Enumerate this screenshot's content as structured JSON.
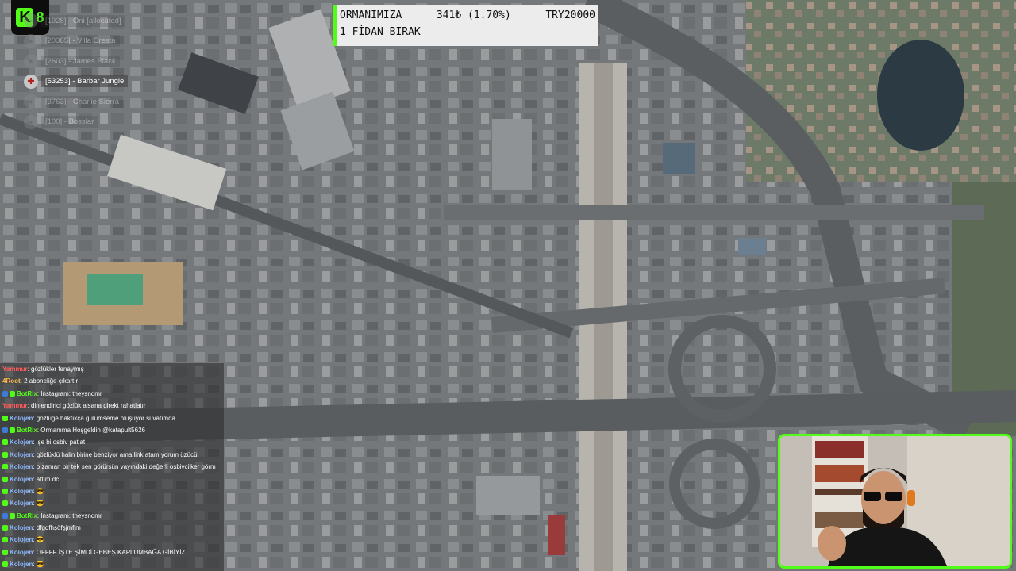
{
  "logo": {
    "mark": "K",
    "number": "8"
  },
  "banner": {
    "line1_left": "ORMANIMIZA",
    "line1_mid": "341₺ (1.70%)",
    "line1_right": "TRY20000",
    "line2": "1 FİDAN BIRAK"
  },
  "players": [
    {
      "text": "[1928] - Oni [allocated]",
      "dim": true
    },
    {
      "text": "[20365] - Villa Cresta",
      "dim": true
    },
    {
      "text": "[2603] - James Black",
      "dim": true
    },
    {
      "text": "[53253] - Barbar Jungle",
      "dim": false
    },
    {
      "text": "[3763] - Charlie Sierra",
      "dim": true
    },
    {
      "text": "[100] - Bosslar",
      "dim": true
    }
  ],
  "chat": [
    {
      "user": "Yammur",
      "color": "#ff5a5a",
      "badge": "",
      "text": ": gözlükler fenaymış"
    },
    {
      "user": "4Root",
      "color": "#ffb84d",
      "badge": "",
      "text": ": 2 aboneliğe çıkartır"
    },
    {
      "user": "BotRix",
      "color": "#53fc18",
      "badge": "bot",
      "text": ": Instagram: theysndmr"
    },
    {
      "user": "Yammur",
      "color": "#ff5a5a",
      "badge": "",
      "text": ": dinlendirici gözlük alsana direkt rahatlatır"
    },
    {
      "user": "Kolojen",
      "color": "#8fb8ff",
      "badge": "sub",
      "text": ": gözlüğe baktıkça gülümseme oluşuyor suvatımda"
    },
    {
      "user": "BotRix",
      "color": "#53fc18",
      "badge": "bot",
      "text": ": Ormanıma Hoşgeldin @katapult5626"
    },
    {
      "user": "Kolojen",
      "color": "#8fb8ff",
      "badge": "sub",
      "text": ": işe bi osbiv patlat"
    },
    {
      "user": "Kolojen",
      "color": "#8fb8ff",
      "badge": "sub",
      "text": ": gözlüklü halin birine benziyor ama link atamıyorum üzücü"
    },
    {
      "user": "Kolojen",
      "color": "#8fb8ff",
      "badge": "sub",
      "text": ": o zaman bir tek sen görürsün yayındaki değerli osbivcilker görm"
    },
    {
      "user": "Kolojen",
      "color": "#8fb8ff",
      "badge": "sub",
      "text": ": attım dc"
    },
    {
      "user": "Kolojen",
      "color": "#8fb8ff",
      "badge": "sub",
      "text": ": 😎"
    },
    {
      "user": "Kolojen",
      "color": "#8fb8ff",
      "badge": "sub",
      "text": ": 😎"
    },
    {
      "user": "BotRix",
      "color": "#53fc18",
      "badge": "bot",
      "text": ": Instagram: theysndmr"
    },
    {
      "user": "Kolojen",
      "color": "#8fb8ff",
      "badge": "sub",
      "text": ": dfgdfhşöfşjmfjm"
    },
    {
      "user": "Kolojen",
      "color": "#8fb8ff",
      "badge": "sub",
      "text": ": 😎"
    },
    {
      "user": "Kolojen",
      "color": "#8fb8ff",
      "badge": "sub",
      "text": ": OFFFF İŞTE ŞİMDİ GEBEŞ KAPLUMBAĞA GİBİYİZ"
    },
    {
      "user": "Kolojen",
      "color": "#8fb8ff",
      "badge": "sub",
      "text": ": 😎"
    }
  ],
  "colors": {
    "accent": "#53fc18",
    "banner_bg": "#ececec"
  },
  "icons": {
    "sub_badge": "green-sub-badge-icon",
    "bot_badge": "blue-bot-badge-icon",
    "avatar": "player-avatar-icon"
  }
}
